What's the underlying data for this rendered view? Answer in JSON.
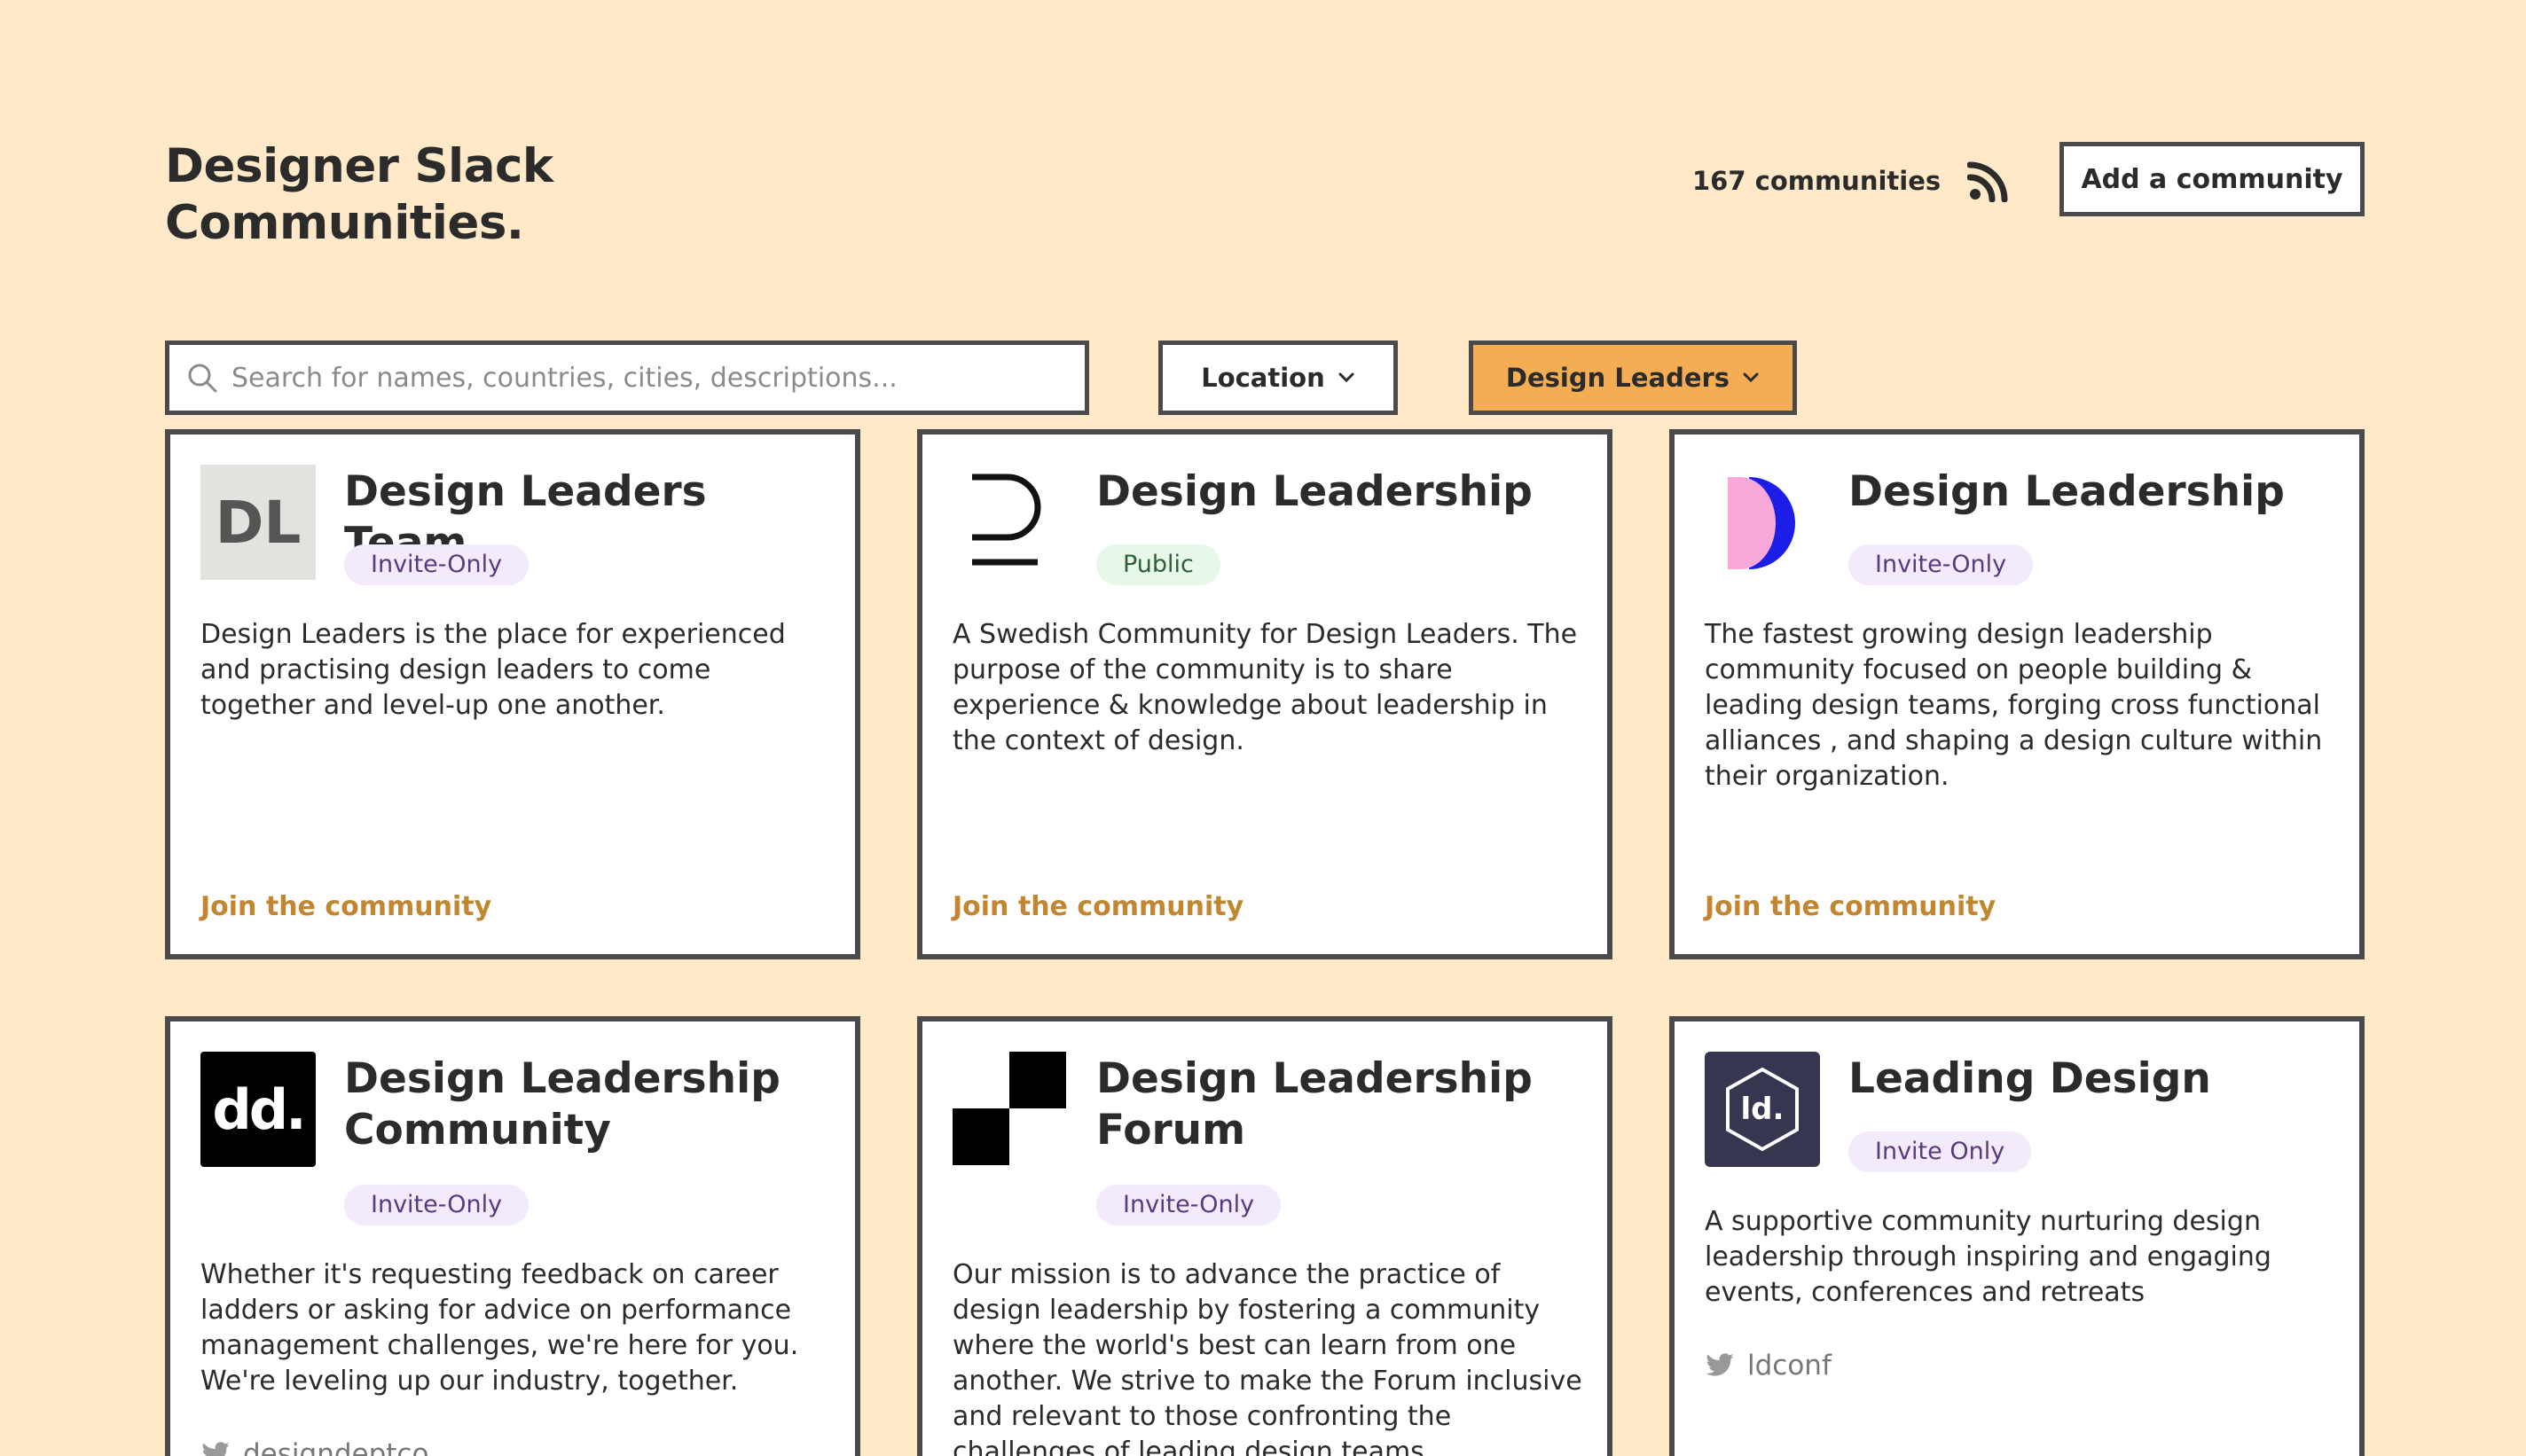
{
  "header": {
    "title": "Designer Slack Communities.",
    "count": "167 communities",
    "rss_icon": "rss-icon",
    "add_label": "Add a community"
  },
  "filters": {
    "search_placeholder": "Search for names, countries, cities, descriptions...",
    "search_value": "",
    "location_label": "Location",
    "category_label": "Design Leaders",
    "accent": "#f4ad52"
  },
  "cards": [
    {
      "name": "Design Leaders Team",
      "logo_text": "DL",
      "badge": "Invite-Only",
      "description": "Design Leaders is the place for experienced and practising design leaders to come together and level-up one another.",
      "link": "Join the community"
    },
    {
      "name": "Design Leadership",
      "badge": "Public",
      "description": "A Swedish Community for Design Leaders. The purpose of the community is to share experience & knowledge about leadership in the context of design.",
      "link": "Join the community"
    },
    {
      "name": "Design Leadership",
      "badge": "Invite-Only",
      "description": "The fastest growing design leadership community focused on people building & leading design teams, forging cross functional alliances , and shaping a design culture within their organization.",
      "link": "Join the community"
    },
    {
      "name": "Design Leadership Community",
      "logo_text": "dd.",
      "badge": "Invite-Only",
      "description": "Whether it's requesting feedback on career ladders or asking for advice on performance management challenges, we're here for you. We're leveling up our industry, together.",
      "twitter": "designdeptco"
    },
    {
      "name": "Design Leadership Forum",
      "badge": "Invite-Only",
      "description": "Our mission is to advance the practice of design leadership by fostering a community where the world's best can learn from one another. We strive to make the Forum inclusive and relevant to those confronting the challenges of leading design teams."
    },
    {
      "name": "Leading Design",
      "logo_text": "ld.",
      "badge": "Invite Only",
      "description": "A supportive community nurturing design leadership through inspiring and engaging events, conferences and retreats",
      "twitter": "ldconf"
    }
  ],
  "colors": {
    "background": "#ffe9c8",
    "border": "#4a4a4a",
    "link": "#c28630"
  }
}
